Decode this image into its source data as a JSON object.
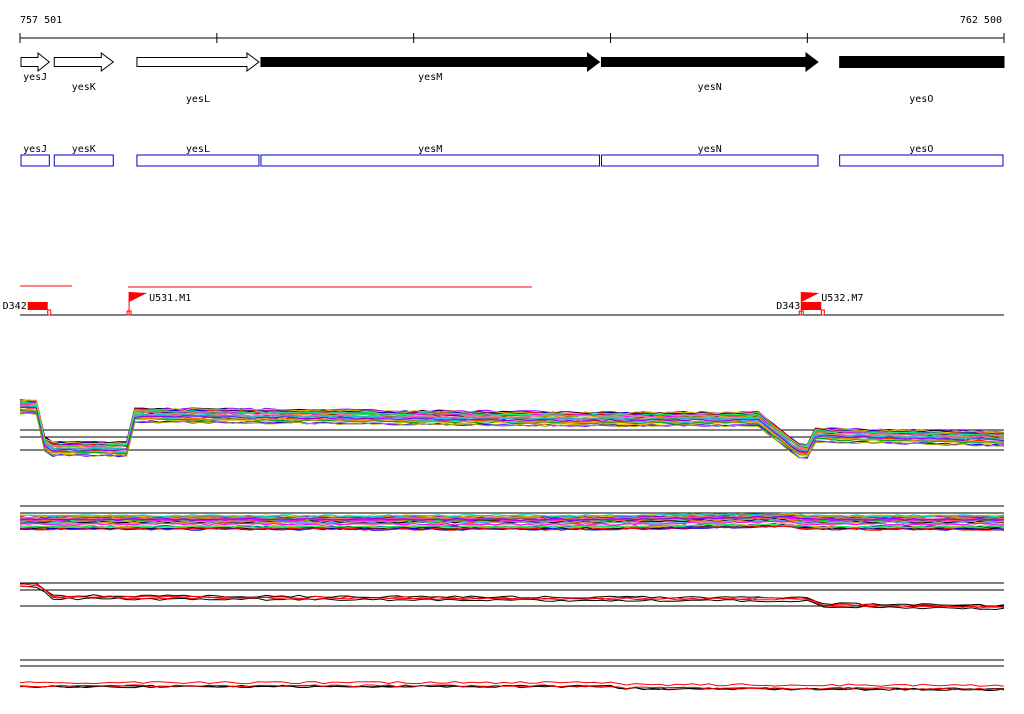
{
  "ruler": {
    "start_label": "757 501",
    "end_label": "762 500",
    "start": 757501,
    "end": 762500,
    "tick_positions": [
      757501,
      758501,
      759501,
      760501,
      761501,
      762500
    ]
  },
  "genes": [
    {
      "name": "yesJ",
      "start": 757501,
      "end": 757655,
      "strand": "+",
      "style": "open",
      "label_row": 1
    },
    {
      "name": "yesK",
      "start": 757670,
      "end": 757980,
      "strand": "+",
      "style": "open",
      "label_row": 2
    },
    {
      "name": "yesL",
      "start": 758090,
      "end": 758720,
      "strand": "+",
      "style": "open",
      "label_row": 3
    },
    {
      "name": "yesM",
      "start": 758720,
      "end": 760450,
      "strand": "+",
      "style": "filled",
      "label_row": 1
    },
    {
      "name": "yesN",
      "start": 760450,
      "end": 761560,
      "strand": "+",
      "style": "filled",
      "label_row": 2
    },
    {
      "name": "yesO",
      "start": 761660,
      "end": 762500,
      "strand": "+",
      "style": "filled",
      "label_row": 3
    }
  ],
  "annotation_boxes": [
    {
      "name": "yesJ",
      "start": 757501,
      "end": 757655
    },
    {
      "name": "yesK",
      "start": 757670,
      "end": 757980
    },
    {
      "name": "yesL",
      "start": 758090,
      "end": 758720
    },
    {
      "name": "yesM",
      "start": 758720,
      "end": 760450
    },
    {
      "name": "yesN",
      "start": 760450,
      "end": 761560
    },
    {
      "name": "yesO",
      "start": 761660,
      "end": 762500
    }
  ],
  "features": [
    {
      "label": "D342",
      "type": "block",
      "position": 757520
    },
    {
      "label": "U531.M1",
      "type": "flag",
      "position": 758045
    },
    {
      "label": "D343",
      "type": "block",
      "position": 761450
    },
    {
      "label": "U532.M7",
      "type": "flag",
      "position": 761460
    }
  ],
  "colors": {
    "gene_box": "#0000cc",
    "feature": "#ff0000",
    "axis": "#000000",
    "track_palette": [
      "#000000",
      "#ff0000",
      "#00a000",
      "#0000ff",
      "#ff00ff",
      "#00cccc",
      "#e0c000",
      "#ff8800",
      "#8800ff",
      "#00ff66",
      "#996633",
      "#ff66aa",
      "#66aaff",
      "#aaaa00",
      "#888888"
    ]
  },
  "chart_data": {
    "type": "line",
    "x_range": [
      757501,
      762500
    ],
    "panels": [
      {
        "id": "panel-1",
        "series_count": 40,
        "pattern": {
          "x": [
            757501,
            757601,
            757621,
            757651,
            758051,
            758071,
            760301,
            761251,
            761461,
            761501,
            761541,
            762500
          ],
          "y": [
            1.2,
            1.2,
            0.3,
            0.15,
            0.15,
            1.0,
            0.9,
            0.9,
            0.1,
            0.1,
            0.5,
            0.4
          ]
        }
      },
      {
        "id": "panel-2",
        "series_count": 40,
        "pattern": {
          "x": [
            757501,
            758501,
            759501,
            760501,
            761401,
            761501,
            762500
          ],
          "y": [
            0.5,
            0.5,
            0.5,
            0.5,
            0.6,
            0.5,
            0.5
          ]
        }
      },
      {
        "id": "panel-3",
        "series_count": 4,
        "pattern": {
          "x": [
            757501,
            757601,
            757661,
            761501,
            761581,
            762500
          ],
          "y": [
            1.3,
            1.3,
            0.7,
            0.6,
            0.3,
            0.2
          ]
        }
      },
      {
        "id": "panel-4",
        "series_count": 4,
        "pattern": {
          "x": [
            757501,
            760501,
            760601,
            762500
          ],
          "y": [
            0.5,
            0.5,
            0.3,
            0.2
          ]
        }
      }
    ]
  }
}
